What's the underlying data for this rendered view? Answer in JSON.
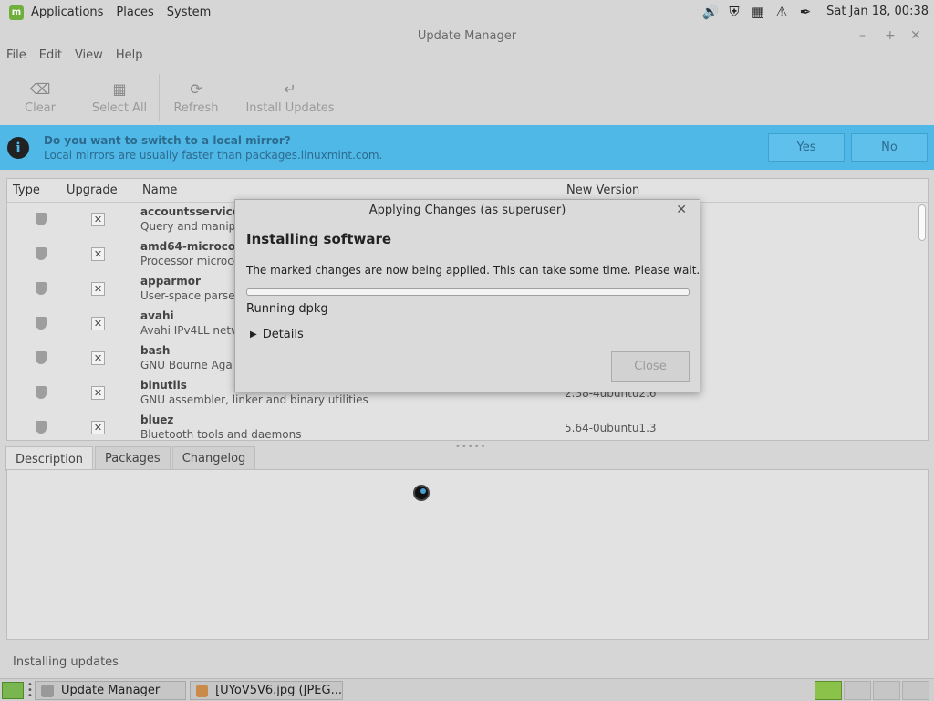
{
  "top_panel": {
    "menus": [
      "Applications",
      "Places",
      "System"
    ],
    "clock": "Sat Jan 18, 00:38",
    "tray_icons": [
      "volume-icon",
      "shield-icon",
      "battery-icon",
      "update-icon",
      "network-icon"
    ]
  },
  "window": {
    "title": "Update Manager",
    "menubar": [
      "File",
      "Edit",
      "View",
      "Help"
    ]
  },
  "toolbar": {
    "clear": "Clear",
    "select_all": "Select All",
    "refresh": "Refresh",
    "install_updates": "Install Updates"
  },
  "infobar": {
    "question": "Do you want to switch to a local mirror?",
    "detail": "Local mirrors are usually faster than packages.linuxmint.com.",
    "yes": "Yes",
    "no": "No"
  },
  "columns": {
    "type": "Type",
    "upgrade": "Upgrade",
    "name": "Name",
    "new_version": "New Version"
  },
  "packages": [
    {
      "name": "accountsservice",
      "desc": "Query and manip",
      "version": ""
    },
    {
      "name": "amd64-microcod",
      "desc": "Processor microco",
      "version": ""
    },
    {
      "name": "apparmor",
      "desc": "User-space parser",
      "version": ""
    },
    {
      "name": "avahi",
      "desc": "Avahi IPv4LL netw",
      "version": ""
    },
    {
      "name": "bash",
      "desc": "GNU Bourne Aga",
      "version": ""
    },
    {
      "name": "binutils",
      "desc": "GNU assembler, linker and binary utilities",
      "version": "2.38-4ubuntu2.6"
    },
    {
      "name": "bluez",
      "desc": "Bluetooth tools and daemons",
      "version": "5.64-0ubuntu1.3"
    }
  ],
  "tabs": [
    "Description",
    "Packages",
    "Changelog"
  ],
  "status": "Installing updates",
  "dialog": {
    "title": "Applying Changes (as superuser)",
    "heading": "Installing software",
    "message": "The marked changes are now being applied. This can take some time. Please wait.",
    "progress_fraction": 0.0,
    "progress_status": "Running dpkg",
    "details_label": "Details",
    "close_label": "Close"
  },
  "taskbar": {
    "tasks": [
      "Update Manager",
      "[UYoV5V6.jpg (JPEG..."
    ]
  },
  "colors": {
    "infobar": "#4fb8e7",
    "accent": "#8bc34a"
  }
}
